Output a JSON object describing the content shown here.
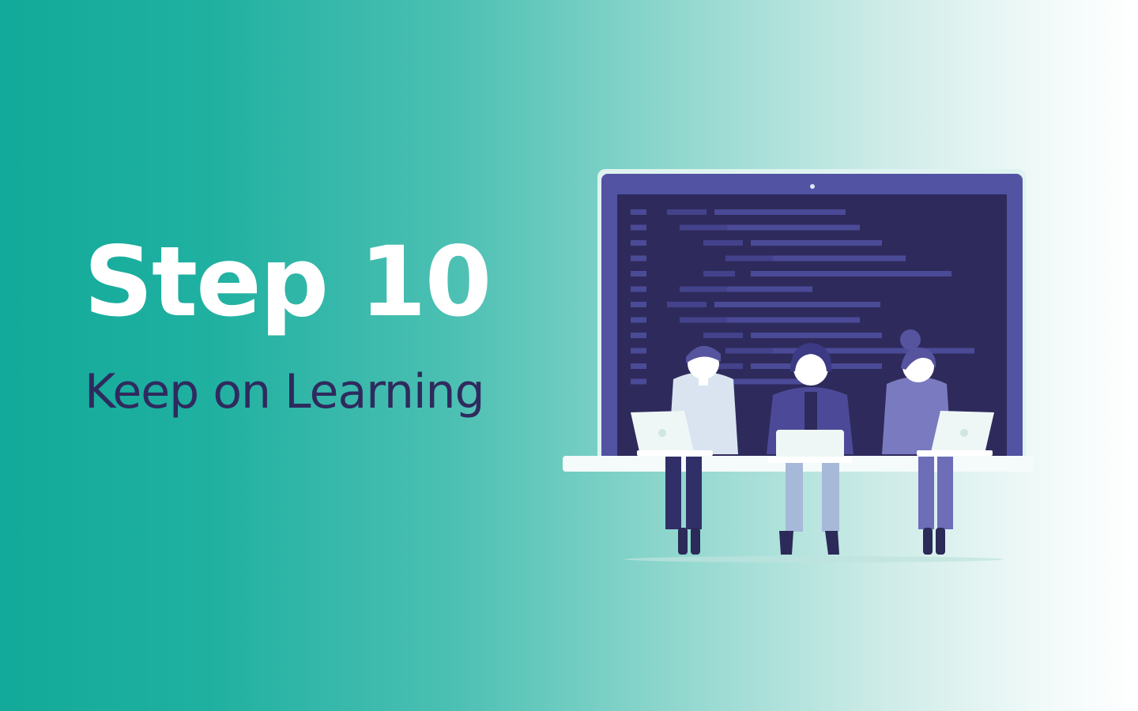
{
  "slide": {
    "title": "Step 10",
    "subtitle": "Keep on Learning"
  },
  "colors": {
    "background_start": "#12aa9a",
    "background_end": "#ffffff",
    "title": "#ffffff",
    "subtitle": "#2f2a5e",
    "monitor_frame": "#4a4a9a",
    "monitor_screen": "#2e2b5c",
    "code_lines": "#4b4a97",
    "people_accent": "#5a5aa8"
  },
  "illustration": {
    "subject": "three people sitting with laptops in front of a large monitor showing code",
    "icons": [
      "monitor-icon",
      "laptop-icon",
      "person-icon"
    ]
  }
}
